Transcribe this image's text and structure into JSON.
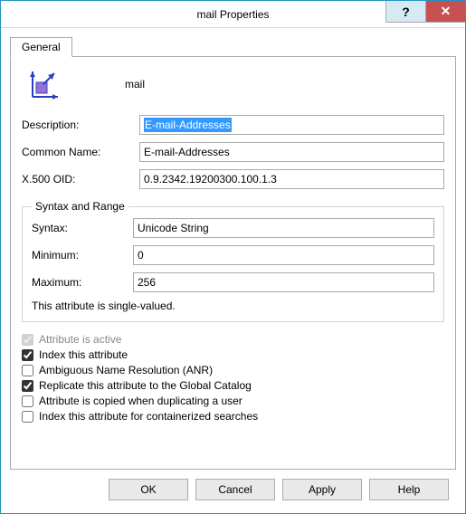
{
  "window": {
    "title": "mail Properties"
  },
  "tab": {
    "general": "General"
  },
  "header": {
    "attribute_name": "mail"
  },
  "fields": {
    "description_label": "Description:",
    "description_value": "E-mail-Addresses",
    "common_name_label": "Common Name:",
    "common_name_value": "E-mail-Addresses",
    "oid_label": "X.500 OID:",
    "oid_value": "0.9.2342.19200300.100.1.3"
  },
  "syntax_group": {
    "legend": "Syntax and Range",
    "syntax_label": "Syntax:",
    "syntax_value": "Unicode String",
    "minimum_label": "Minimum:",
    "minimum_value": "0",
    "maximum_label": "Maximum:",
    "maximum_value": "256",
    "note": "This attribute is single-valued."
  },
  "checks": {
    "active": "Attribute is active",
    "index": "Index this attribute",
    "anr": "Ambiguous Name Resolution (ANR)",
    "replicate": "Replicate this attribute to the Global Catalog",
    "copy_dup": "Attribute is copied when duplicating a user",
    "index_container": "Index this attribute for containerized searches"
  },
  "buttons": {
    "ok": "OK",
    "cancel": "Cancel",
    "apply": "Apply",
    "help": "Help"
  }
}
